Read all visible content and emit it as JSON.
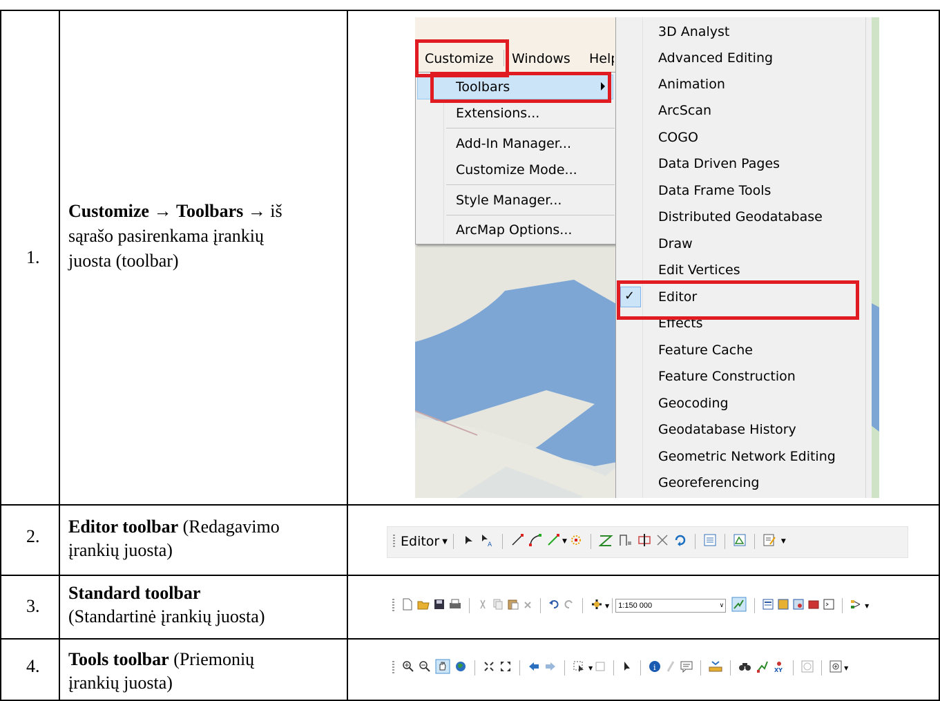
{
  "rows": [
    {
      "num": "1.",
      "desc_bold1": "Customize",
      "arrow1": " → ",
      "desc_bold2": "Toolbars",
      "arrow2": " → ",
      "desc_rest1": "iš",
      "desc_line2": "sąrašo pasirenkama įrankių",
      "desc_line3": "juosta (toolbar)"
    },
    {
      "num": "2.",
      "bold": "Editor toolbar",
      "rest": " (Redagavimo",
      "line2": "įrankių juosta)"
    },
    {
      "num": "3.",
      "bold": "Standard toolbar",
      "line2": "(Standartinė įrankių juosta)"
    },
    {
      "num": "4.",
      "bold": "Tools toolbar",
      "rest": " (Priemonių",
      "line2": "įrankių juosta)"
    }
  ],
  "menubar": {
    "customize": "Customize",
    "windows": "Windows",
    "help": "Help"
  },
  "customize_menu": [
    "Toolbars",
    "Extensions...",
    "Add-In Manager...",
    "Customize Mode...",
    "Style Manager...",
    "ArcMap Options..."
  ],
  "toolbars_menu": [
    "3D Analyst",
    "Advanced Editing",
    "Animation",
    "ArcScan",
    "COGO",
    "Data Driven Pages",
    "Data Frame Tools",
    "Distributed Geodatabase",
    "Draw",
    "Edit Vertices",
    "Editor",
    "Effects",
    "Feature Cache",
    "Feature Construction",
    "Geocoding",
    "Geodatabase History",
    "Geometric Network Editing",
    "Georeferencing"
  ],
  "checked_item": "Editor",
  "editor_toolbar": {
    "label": "Editor"
  },
  "standard_toolbar": {
    "scale": "1:150 000"
  },
  "colors": {
    "highlight": "#e01b22",
    "menu_selected": "#cce4f7",
    "water": "#7ea6d4",
    "land": "#e6e6df",
    "park": "#cfe3c6"
  }
}
